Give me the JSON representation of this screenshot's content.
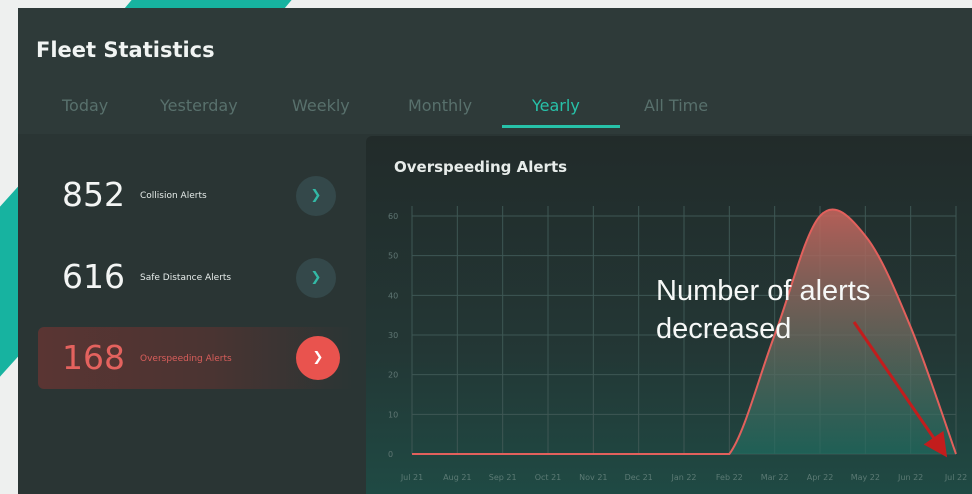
{
  "page": {
    "title": "Fleet Statistics"
  },
  "tabs": [
    {
      "label": "Today",
      "active": false
    },
    {
      "label": "Yesterday",
      "active": false
    },
    {
      "label": "Weekly",
      "active": false
    },
    {
      "label": "Monthly",
      "active": false
    },
    {
      "label": "Yearly",
      "active": true
    },
    {
      "label": "All Time",
      "active": false
    }
  ],
  "stats": [
    {
      "value": "852",
      "label": "Collision Alerts",
      "button_icon": "chevron-right-icon"
    },
    {
      "value": "616",
      "label": "Safe Distance Alerts",
      "button_icon": "chevron-right-icon"
    },
    {
      "value": "168",
      "label": "Overspeeding Alerts",
      "button_icon": "chevron-right-icon",
      "selected": true
    }
  ],
  "chart": {
    "title": "Overspeeding Alerts",
    "annotation": "Number of alerts\ndecreased"
  },
  "chart_data": {
    "type": "area",
    "title": "Overspeeding Alerts",
    "x": [
      "Jul 21",
      "Aug 21",
      "Sep 21",
      "Oct 21",
      "Nov 21",
      "Dec 21",
      "Jan 22",
      "Feb 22",
      "Mar 22",
      "Apr 22",
      "May 22",
      "Jun 22",
      "Jul 22"
    ],
    "series": [
      {
        "values": [
          0,
          0,
          0,
          0,
          0,
          0,
          0,
          0,
          30,
          60,
          55,
          32,
          0
        ]
      }
    ],
    "y_ticks": [
      "0",
      "10",
      "20",
      "30",
      "40",
      "50",
      "60"
    ],
    "ylim": [
      0,
      60
    ],
    "grid": true,
    "colors": {
      "line": "#e2605c",
      "fill_top": "#c4645c",
      "fill_bottom": "#1f6f62",
      "grid": "#3e5754",
      "arrow": "#c21d1d"
    }
  }
}
